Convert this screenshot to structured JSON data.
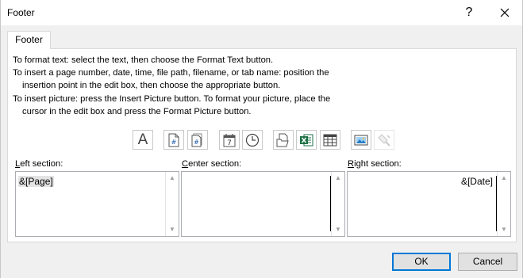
{
  "window": {
    "title": "Footer",
    "help_glyph": "?"
  },
  "tab": {
    "label": "Footer"
  },
  "instructions": [
    "To format text:  select the text, then choose the Format Text button.",
    "To insert a page number, date, time, file path, filename, or tab name:  position the",
    "insertion point in the edit box, then choose the appropriate button.",
    "To insert picture: press the Insert Picture button.  To format your picture, place the",
    "cursor in the edit box and press the Format Picture button."
  ],
  "toolbar": {
    "icons": [
      "format-text-icon",
      "insert-page-number-icon",
      "insert-number-of-pages-icon",
      "insert-date-icon",
      "insert-time-icon",
      "insert-file-path-icon",
      "insert-file-name-icon",
      "insert-sheet-name-icon",
      "insert-picture-icon",
      "format-picture-icon"
    ],
    "format_text_glyph": "A",
    "date_glyph": "7"
  },
  "sections": {
    "left": {
      "label_pre": "",
      "label_u": "L",
      "label_post": "eft section:",
      "value": "&[Page]"
    },
    "center": {
      "label_pre": "",
      "label_u": "C",
      "label_post": "enter section:",
      "value": ""
    },
    "right": {
      "label_pre": "",
      "label_u": "R",
      "label_post": "ight section:",
      "value": "&[Date]"
    }
  },
  "buttons": {
    "ok": "OK",
    "cancel": "Cancel"
  },
  "colors": {
    "accent": "#0078d7",
    "excel_green": "#1d7044",
    "selection": "#cce8ff"
  }
}
